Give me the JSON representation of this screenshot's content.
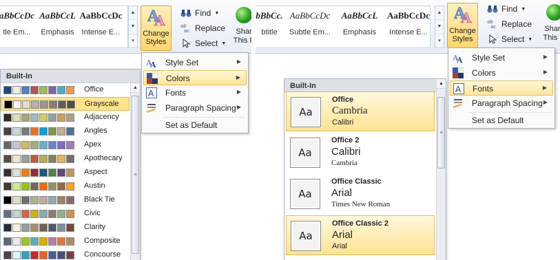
{
  "left": {
    "ribbon": {
      "styles": [
        {
          "sample": "aBbCcDc",
          "name": "tle Em..."
        },
        {
          "sample": "AaBbCcL",
          "name": "Emphasis"
        },
        {
          "sample": "AaBbCcDc",
          "name": "Intense E..."
        }
      ],
      "change_styles_label": "Change Styles",
      "find_label": "Find",
      "replace_label": "Replace",
      "select_label": "Select",
      "share_label": "Shar This F"
    },
    "menu": {
      "items": [
        {
          "label": "Style Set",
          "icon": "style-set-icon"
        },
        {
          "label": "Colors",
          "icon": "colors-icon"
        },
        {
          "label": "Fonts",
          "icon": "fonts-icon"
        },
        {
          "label": "Paragraph Spacing",
          "icon": "paragraph-spacing-icon"
        },
        {
          "label": "Set as Default"
        }
      ]
    },
    "colors_gallery": {
      "header": "Built-In",
      "themes": [
        {
          "name": "Office",
          "colors": [
            "#1f497d",
            "#eeece1",
            "#4f81bd",
            "#c0504d",
            "#9bbb59",
            "#8064a2",
            "#4bacc6",
            "#f79646"
          ]
        },
        {
          "name": "Grayscale",
          "colors": [
            "#000000",
            "#f8f8f8",
            "#dddddd",
            "#b2b2b2",
            "#969696",
            "#808080",
            "#5f5f5f",
            "#4d4d4d"
          ]
        },
        {
          "name": "Adjacency",
          "colors": [
            "#2f2b20",
            "#dfdcb7",
            "#a9a57c",
            "#9cbebd",
            "#d2cb6c",
            "#95a39d",
            "#c89f5d",
            "#b1a089"
          ]
        },
        {
          "name": "Angles",
          "colors": [
            "#434342",
            "#cdd7d9",
            "#797b7e",
            "#f96a1b",
            "#08a1d9",
            "#7c984a",
            "#c2ad8d",
            "#506e94"
          ]
        },
        {
          "name": "Apex",
          "colors": [
            "#69676d",
            "#c9c2d1",
            "#ceb966",
            "#9cb084",
            "#6bb1c9",
            "#6585cf",
            "#7e6bc9",
            "#a379bb"
          ]
        },
        {
          "name": "Apothecary",
          "colors": [
            "#564b3c",
            "#ece9c6",
            "#93a299",
            "#cf543f",
            "#b5ae53",
            "#848058",
            "#e8b54d",
            "#786c71"
          ]
        },
        {
          "name": "Aspect",
          "colors": [
            "#323232",
            "#e3ded1",
            "#f07f09",
            "#9f2936",
            "#1b587c",
            "#4e8542",
            "#604878",
            "#c19859"
          ]
        },
        {
          "name": "Austin",
          "colors": [
            "#3e3d2d",
            "#caf278",
            "#94c600",
            "#71685a",
            "#ff6700",
            "#909465",
            "#956b43",
            "#fea022"
          ]
        },
        {
          "name": "Black Tie",
          "colors": [
            "#000000",
            "#e3dcc5",
            "#6f6f74",
            "#a7b789",
            "#beae98",
            "#92a9b9",
            "#9c8265",
            "#8d6974"
          ]
        },
        {
          "name": "Civic",
          "colors": [
            "#646b86",
            "#c5d1d7",
            "#d16349",
            "#ccb400",
            "#8cadae",
            "#8c7b70",
            "#8fb08c",
            "#d19049"
          ]
        },
        {
          "name": "Clarity",
          "colors": [
            "#292934",
            "#f3f2dc",
            "#93a299",
            "#ad8f67",
            "#726056",
            "#4c5a6a",
            "#808da0",
            "#79463d"
          ]
        },
        {
          "name": "Composite",
          "colors": [
            "#5b6973",
            "#e7ecf1",
            "#98c723",
            "#59b0b9",
            "#deae00",
            "#b77bb4",
            "#e0773c",
            "#a98d63"
          ]
        },
        {
          "name": "Concourse",
          "colors": [
            "#464646",
            "#def5fa",
            "#2da2bf",
            "#da1f28",
            "#eb641b",
            "#39639d",
            "#474b78",
            "#7d3c4a"
          ]
        }
      ]
    }
  },
  "right": {
    "ribbon": {
      "styles": [
        {
          "sample": "bBbCc.",
          "name": "btitle"
        },
        {
          "sample": "AaBbCcDc",
          "name": "Subtle Em..."
        },
        {
          "sample": "AaBbCcL",
          "name": "Emphasis"
        },
        {
          "sample": "AaBbCcDc",
          "name": "Intense E..."
        }
      ],
      "change_styles_label": "Change Styles",
      "find_label": "Find",
      "replace_label": "Replace",
      "select_label": "Select",
      "share_label": "Share This Fi"
    },
    "menu": {
      "items": [
        {
          "label": "Style Set",
          "icon": "style-set-icon"
        },
        {
          "label": "Colors",
          "icon": "colors-icon"
        },
        {
          "label": "Fonts",
          "icon": "fonts-icon"
        },
        {
          "label": "Paragraph Spacing",
          "icon": "paragraph-spacing-icon"
        },
        {
          "label": "Set as Default"
        }
      ]
    },
    "fonts_gallery": {
      "header": "Built-In",
      "themes": [
        {
          "name": "Office",
          "preview": "Aa",
          "heading": "Cambria",
          "body": "Calibri"
        },
        {
          "name": "Office 2",
          "preview": "Aa",
          "heading": "Calibri",
          "body": "Cambria"
        },
        {
          "name": "Office Classic",
          "preview": "Aa",
          "heading": "Arial",
          "body": "Times New Roman"
        },
        {
          "name": "Office Classic 2",
          "preview": "Aa",
          "heading": "Arial",
          "body": "Arial"
        }
      ]
    }
  }
}
